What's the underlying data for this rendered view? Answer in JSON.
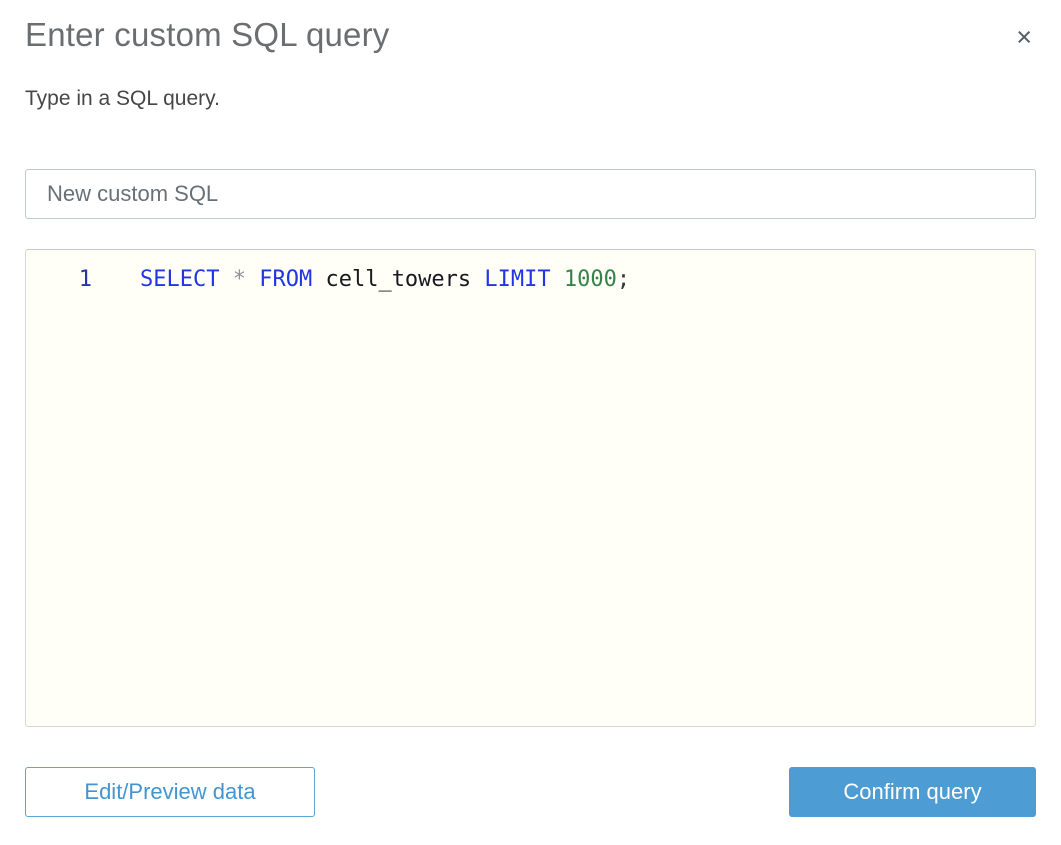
{
  "dialog": {
    "title": "Enter custom SQL query",
    "subtitle": "Type in a SQL query.",
    "close_icon": "×"
  },
  "name_input": {
    "value": "New custom SQL"
  },
  "editor": {
    "line_number": "1",
    "query_text": "SELECT * FROM cell_towers LIMIT 1000;",
    "tokens": [
      {
        "t": "SELECT",
        "c": "keyword"
      },
      {
        "t": " ",
        "c": "plain"
      },
      {
        "t": "*",
        "c": "operator"
      },
      {
        "t": " ",
        "c": "plain"
      },
      {
        "t": "FROM",
        "c": "keyword"
      },
      {
        "t": " cell_towers ",
        "c": "identifier"
      },
      {
        "t": "LIMIT",
        "c": "keyword"
      },
      {
        "t": " ",
        "c": "plain"
      },
      {
        "t": "1000",
        "c": "number"
      },
      {
        "t": ";",
        "c": "plain"
      }
    ]
  },
  "footer": {
    "edit_preview_label": "Edit/Preview data",
    "confirm_label": "Confirm query"
  },
  "colors": {
    "accent_blue": "#4d9cd3",
    "keyword_blue": "#2135e3",
    "number_green": "#35834a",
    "gutter_navy": "#27359e",
    "title_gray": "#6b6e70",
    "editor_background": "#fffef7"
  }
}
